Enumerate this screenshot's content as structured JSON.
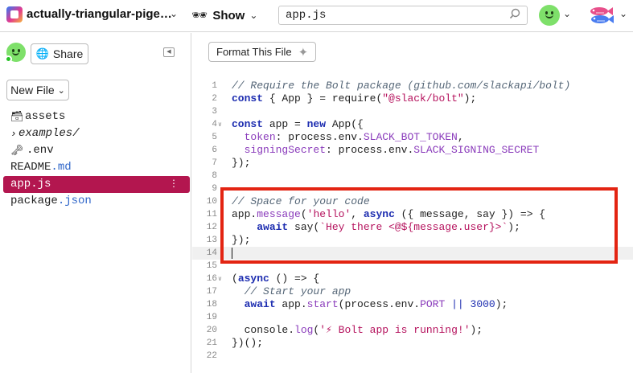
{
  "topbar": {
    "project_name": "actually-triangular-pige…",
    "show_label": "Show",
    "search_value": "app.js"
  },
  "sidebar": {
    "share_label": "Share",
    "new_file_label": "New File",
    "files": [
      {
        "name": "assets",
        "ext": "",
        "icon": "box-icon"
      },
      {
        "name": "examples/",
        "ext": "",
        "icon": "chevron-right-icon"
      },
      {
        "name": ".env",
        "ext": "",
        "icon": "key-icon"
      },
      {
        "name": "README",
        "ext": ".md",
        "icon": ""
      },
      {
        "name": "app",
        "ext": ".js",
        "icon": ""
      },
      {
        "name": "package",
        "ext": ".json",
        "icon": ""
      }
    ],
    "active_file": "app.js"
  },
  "editor": {
    "format_label": "Format This File",
    "lines": [
      {
        "n": "1",
        "text": "// Require the Bolt package (github.com/slackapi/bolt)"
      },
      {
        "n": "2",
        "text": "const { App } = require(\"@slack/bolt\");"
      },
      {
        "n": "3",
        "text": ""
      },
      {
        "n": "4",
        "text": "const app = new App({"
      },
      {
        "n": "5",
        "text": "  token: process.env.SLACK_BOT_TOKEN,"
      },
      {
        "n": "6",
        "text": "  signingSecret: process.env.SLACK_SIGNING_SECRET"
      },
      {
        "n": "7",
        "text": "});"
      },
      {
        "n": "8",
        "text": ""
      },
      {
        "n": "9",
        "text": ""
      },
      {
        "n": "10",
        "text": "// Space for your code"
      },
      {
        "n": "11",
        "text": "app.message('hello', async ({ message, say }) => {"
      },
      {
        "n": "12",
        "text": "    await say(`Hey there <@${message.user}>`);"
      },
      {
        "n": "13",
        "text": "});"
      },
      {
        "n": "14",
        "text": ""
      },
      {
        "n": "15",
        "text": ""
      },
      {
        "n": "16",
        "text": "(async () => {"
      },
      {
        "n": "17",
        "text": "  // Start your app"
      },
      {
        "n": "18",
        "text": "  await app.start(process.env.PORT || 3000);"
      },
      {
        "n": "19",
        "text": ""
      },
      {
        "n": "20",
        "text": "  console.log('⚡ Bolt app is running!');"
      },
      {
        "n": "21",
        "text": "})();"
      },
      {
        "n": "22",
        "text": ""
      }
    ]
  },
  "colors": {
    "active_file_bg": "#b3164f",
    "highlight_border": "#e32412",
    "keyword": "#1d2db0",
    "string": "#b5125d"
  }
}
